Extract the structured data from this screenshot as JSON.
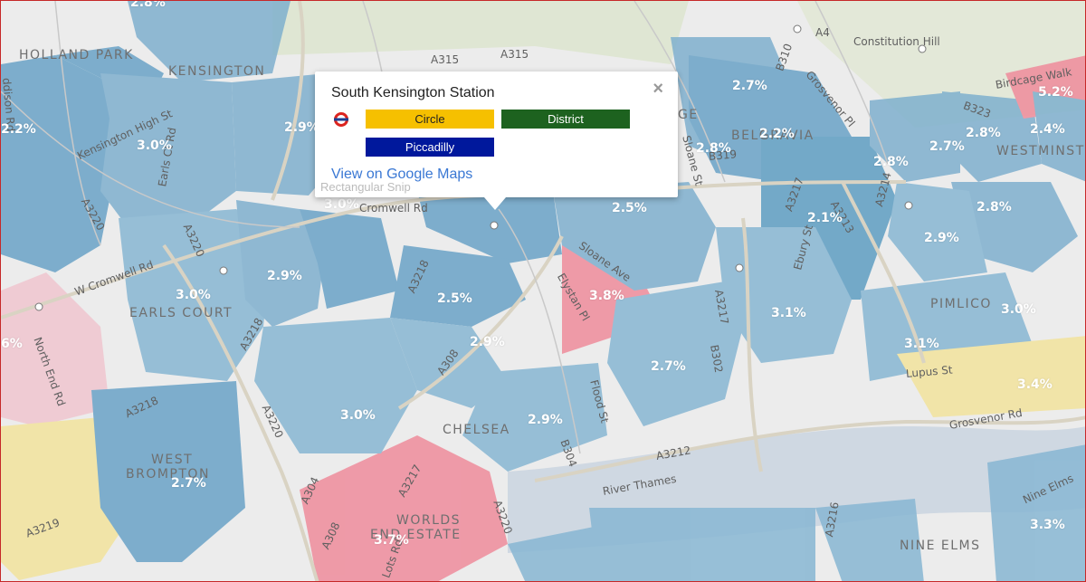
{
  "colors": {
    "low": "#5f9ec2",
    "mid": "#8fbcd6",
    "high": "#ee8898",
    "med_high": "#f1e29b",
    "circle_line": "#f6c000",
    "district_line": "#1d621f",
    "piccadilly_line": "#00189c",
    "link": "#3a78d4"
  },
  "area_labels": [
    "HOLLAND PARK",
    "KENSINGTON",
    "EARLS COURT",
    "WEST",
    "BROMPTON",
    "CHELSEA",
    "WORLDS",
    "END ESTATE",
    "PIMLICO",
    "NINE ELMS",
    "WESTMINSTE",
    "BELGRAVIA",
    "GE"
  ],
  "road_labels": [
    "A315",
    "A315",
    "A4",
    "Constitution Hill",
    "Birdcage Walk",
    "Grosvenor Pl",
    "B323",
    "B310",
    "Kensington High St",
    "Earls Ct Rd",
    "A3220",
    "A3220",
    "W Cromwell Rd",
    "Cromwell Rd",
    "North End Rd",
    "A3218",
    "A3218",
    "A3218",
    "A3220",
    "A308",
    "Sloane Ave",
    "Elystan Pl",
    "A3217",
    "Flood St",
    "B304",
    "A3212",
    "River Thames",
    "Grosvenor Rd",
    "Lupus St",
    "Nine Elms",
    "A3219",
    "A304",
    "A3217",
    "A308",
    "A3220",
    "Lots Rd",
    "A3216",
    "B302",
    "A3217",
    "A3213",
    "Ebury St",
    "A3214",
    "Sloane St",
    "B319",
    "ddison Rd"
  ],
  "percent_labels": [
    "2.8%",
    "2.2%",
    "3.0%",
    "2.9%",
    "3.0%",
    "2.9%",
    "3.0%",
    "2.5%",
    "2.9%",
    "3.8%",
    "3.0%",
    "2.9%",
    "2.7%",
    "2.7%",
    "2.5%",
    "2.8%",
    "2.2%",
    "2.8%",
    "2.7%",
    "2.8%",
    "2.4%",
    "5.2%",
    "2.1%",
    "2.9%",
    "2.8%",
    "3.1%",
    "3.1%",
    "3.0%",
    "3.4%",
    "3.3%",
    "6%",
    "3.7%",
    "2.7%"
  ],
  "popup": {
    "title": "South Kensington Station",
    "close": "×",
    "lines": [
      "Circle",
      "District",
      "Piccadilly"
    ],
    "link": "View on Google Maps",
    "icon": "underground-roundel-icon"
  },
  "ghost_text": "Rectangular Snip"
}
